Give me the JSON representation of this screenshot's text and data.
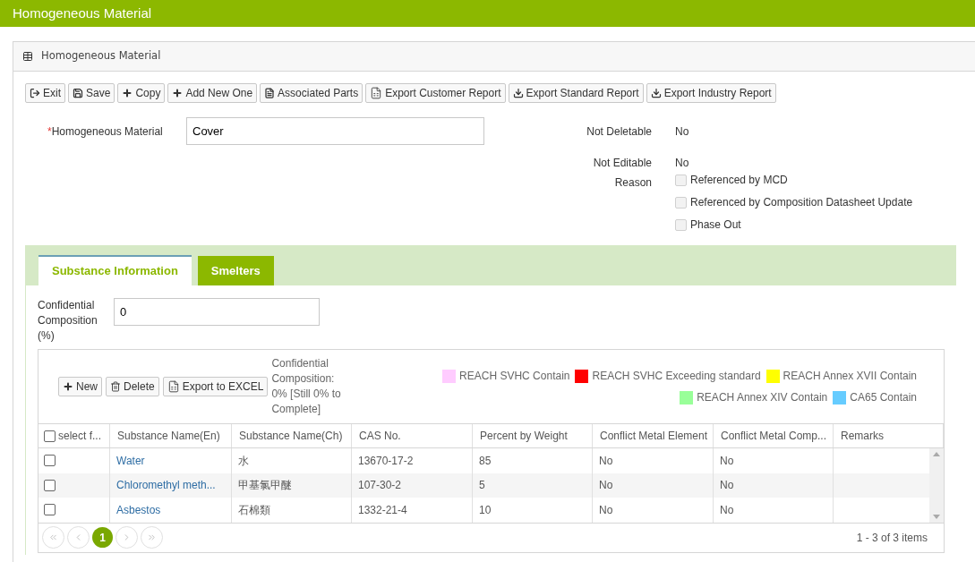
{
  "app_title": "Homogeneous Material",
  "panel_title": "Homogeneous Material",
  "toolbar": [
    {
      "label": "Exit",
      "kind": "exit"
    },
    {
      "label": "Save",
      "kind": "save"
    },
    {
      "label": "Copy",
      "kind": "add"
    },
    {
      "label": "Add New One",
      "kind": "add"
    },
    {
      "label": "Associated Parts",
      "kind": "document"
    },
    {
      "label": "Export Customer Report",
      "kind": "excel"
    },
    {
      "label": "Export Standard Report",
      "kind": "download"
    },
    {
      "label": "Export Industry Report",
      "kind": "download"
    }
  ],
  "material_field": {
    "required_mark": "*",
    "label": "Homogeneous Material",
    "value": "Cover"
  },
  "not_deletable": {
    "label": "Not Deletable",
    "value": "No"
  },
  "not_editable": {
    "label": "Not Editable",
    "value": "No"
  },
  "reason": {
    "label": "Reason",
    "options": [
      {
        "label": "Referenced by MCD",
        "checked": false
      },
      {
        "label": "Referenced by Composition Datasheet Update",
        "checked": false
      },
      {
        "label": "Phase Out",
        "checked": false
      }
    ]
  },
  "tabs": [
    {
      "label": "Substance Information",
      "selected": true
    },
    {
      "label": "Smelters",
      "selected": false
    }
  ],
  "confidential_field": {
    "label": "Confidential Composition (%)",
    "value": "0"
  },
  "grid_toolbar": [
    {
      "label": "New",
      "kind": "add"
    },
    {
      "label": "Delete",
      "kind": "trash"
    },
    {
      "label": "Export to EXCEL",
      "kind": "excel"
    }
  ],
  "composition_note": "Confidential Composition: 0% [Still 0% to Complete]",
  "legend": [
    {
      "label": "REACH SVHC Contain",
      "color": "#ffccff"
    },
    {
      "label": "REACH SVHC Exceeding standard",
      "color": "#ff0000"
    },
    {
      "label": "REACH Annex XVII Contain",
      "color": "#ffff00"
    },
    {
      "label": "REACH Annex XIV Contain",
      "color": "#99ff99"
    },
    {
      "label": "CA65 Contain",
      "color": "#66ccff"
    }
  ],
  "table": {
    "select_all": {
      "label": "select f...",
      "checked": false
    },
    "columns": [
      "Substance Name(En)",
      "Substance Name(Ch)",
      "CAS No.",
      "Percent by Weight",
      "Conflict Metal Element",
      "Conflict Metal Comp...",
      "Remarks"
    ],
    "rows": [
      {
        "selected": false,
        "cells": [
          "Water",
          "水",
          "13670-17-2",
          "85",
          "No",
          "No",
          ""
        ]
      },
      {
        "selected": false,
        "cells": [
          "Chloromethyl meth...",
          "甲基氯甲醚",
          "107-30-2",
          "5",
          "No",
          "No",
          ""
        ]
      },
      {
        "selected": false,
        "cells": [
          "Asbestos",
          "石棉類",
          "1332-21-4",
          "10",
          "No",
          "No",
          ""
        ]
      }
    ]
  },
  "pager": {
    "pages": [
      {
        "label": "1",
        "selected": true
      }
    ],
    "summary": "1 - 3 of 3 items"
  }
}
